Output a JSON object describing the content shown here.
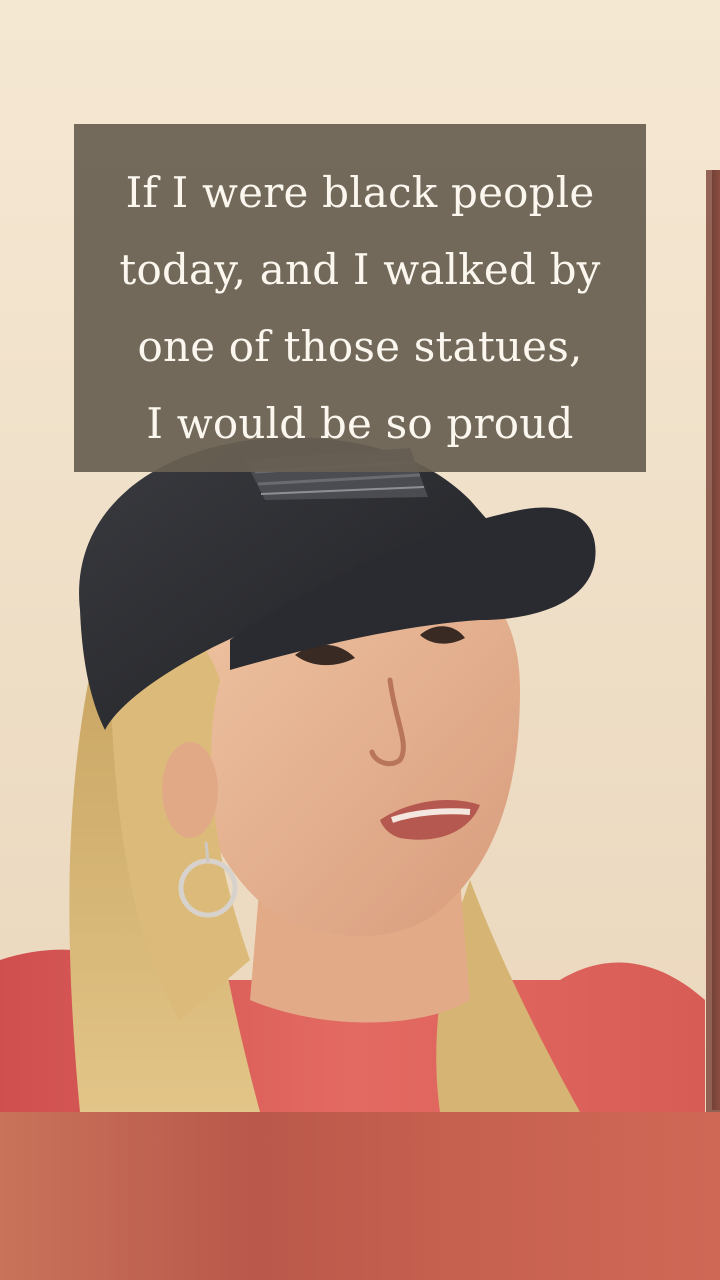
{
  "caption": {
    "lines": [
      "If I were black people",
      "today, and I walked by",
      "one of those statues,",
      "I would be so proud"
    ]
  },
  "colors": {
    "caption_background": "#686052",
    "caption_text": "#fbf7ef",
    "wall": "#f2e4cf",
    "cap": "#2c2d31",
    "hair": "#d9b774",
    "shirt": "#d65a55",
    "bottom_band": "#b9584b"
  }
}
